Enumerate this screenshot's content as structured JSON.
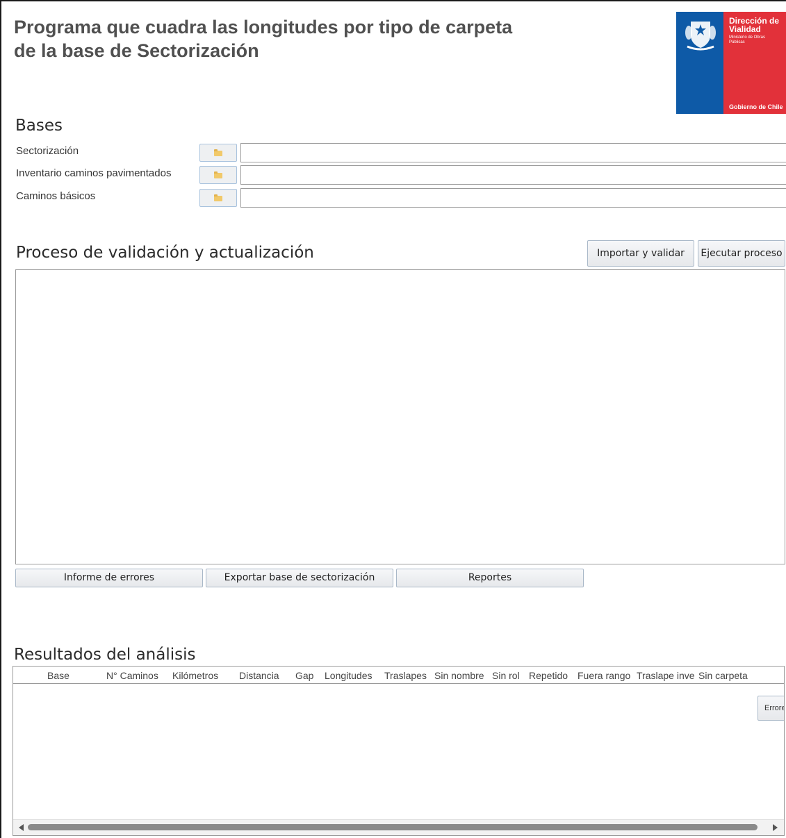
{
  "header": {
    "title_line1": "Programa que cuadra las longitudes por tipo de carpeta",
    "title_line2": "de la base de Sectorización"
  },
  "logo": {
    "org_line1": "Dirección de",
    "org_line2": "Vialidad",
    "ministry_line1": "Ministerio de Obras",
    "ministry_line2": "Públicas",
    "government": "Gobierno de Chile",
    "colors": {
      "blue": "#0e5aa7",
      "red": "#e2313a"
    }
  },
  "bases": {
    "title": "Bases",
    "rows": [
      {
        "label": "Sectorización",
        "value": "",
        "icon": "folder-icon"
      },
      {
        "label": "Inventario caminos pavimentados",
        "value": "",
        "icon": "folder-icon"
      },
      {
        "label": "Caminos básicos",
        "value": "",
        "icon": "folder-icon"
      }
    ]
  },
  "process": {
    "title": "Proceso de validación y actualización",
    "import_label": "Importar y validar",
    "run_label": "Ejecutar proceso",
    "log_text": "",
    "actions": {
      "errors_report": "Informe de errores",
      "export": "Exportar base de sectorización",
      "reports": "Reportes"
    }
  },
  "results": {
    "title": "Resultados del análisis",
    "columns": [
      "Base",
      "N° Caminos",
      "Kilómetros",
      "Distancia",
      "Gap",
      "Longitudes",
      "Traslapes",
      "Sin nombre",
      "Sin rol",
      "Repetido",
      "Fuera rango",
      "Traslape inve",
      "Sin carpeta"
    ],
    "row_button_label": "Errores",
    "rows": []
  }
}
